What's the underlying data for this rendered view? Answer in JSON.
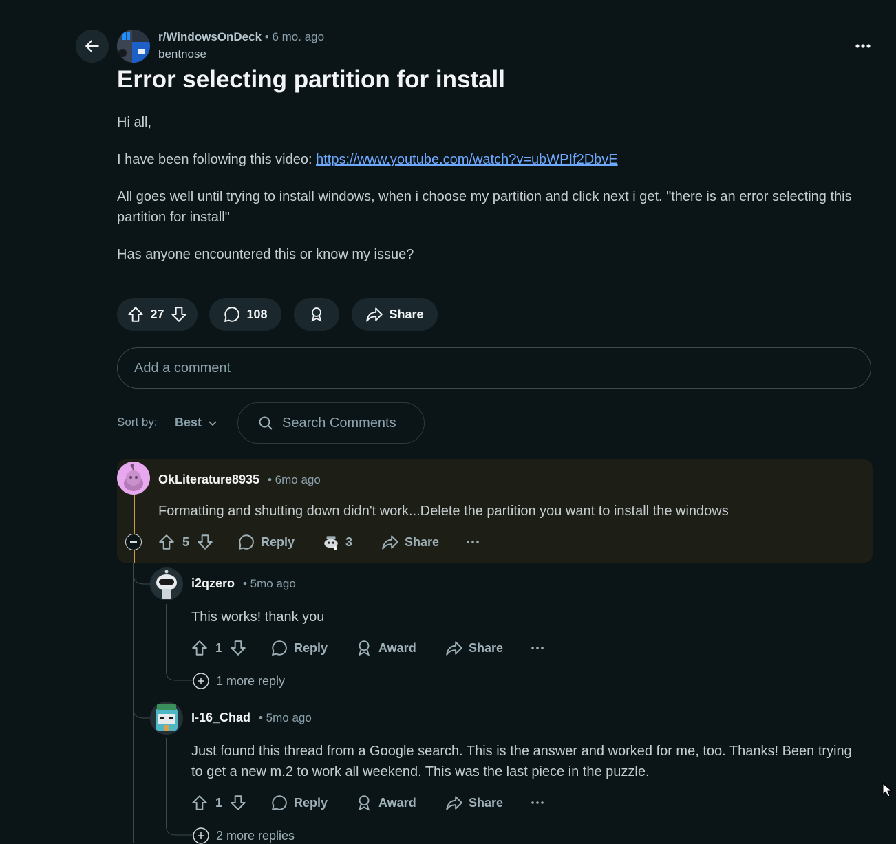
{
  "post": {
    "subreddit": "r/WindowsOnDeck",
    "time": "• 6 mo. ago",
    "author": "bentnose",
    "title": "Error selecting partition for install",
    "greeting": "Hi all,",
    "video_prefix": "I have been following this video: ",
    "video_link": "https://www.youtube.com/watch?v=ubWPIf2DbvE",
    "paragraph2": "All goes well until trying to install windows, when i choose my partition and click next i get. \"there is an error selecting this partition for install\"",
    "paragraph3": "Has anyone encountered this or know my issue?",
    "votes": "27",
    "comments": "108",
    "share_label": "Share"
  },
  "comment_box": {
    "placeholder": "Add a comment"
  },
  "sort": {
    "label": "Sort by:",
    "value": "Best"
  },
  "search": {
    "placeholder": "Search Comments"
  },
  "comments": [
    {
      "user": "OkLiterature8935",
      "time": "• 6mo ago",
      "text": "Formatting and shutting down didn't work...Delete the partition you want to install the windows",
      "votes": "5",
      "reply_label": "Reply",
      "awards": "3",
      "share_label": "Share",
      "highlight_color": "#1d1e16"
    },
    {
      "user": "i2qzero",
      "time": "• 5mo ago",
      "text": "This works! thank you",
      "votes": "1",
      "reply_label": "Reply",
      "award_label": "Award",
      "share_label": "Share",
      "more_replies": "1 more reply"
    },
    {
      "user": "I-16_Chad",
      "time": "• 5mo ago",
      "text": "Just found this thread from a Google search. This is the answer and worked for me, too. Thanks! Been trying to get a new m.2 to work all weekend. This was the last piece in the puzzle.",
      "votes": "1",
      "reply_label": "Reply",
      "award_label": "Award",
      "share_label": "Share",
      "more_replies": "2 more replies"
    }
  ],
  "colors": {
    "background": "#0b1416",
    "link": "#6ea8ff",
    "thread_line_active": "#c8a03a"
  }
}
